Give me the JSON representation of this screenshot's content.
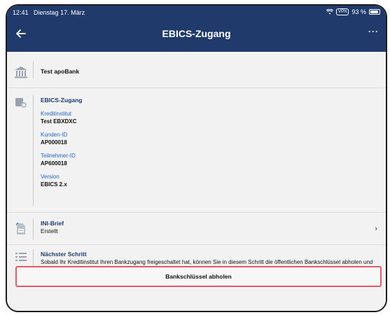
{
  "status": {
    "time": "12:41",
    "date": "Dienstag 17. März",
    "vpn": "VPN",
    "battery": "93 %"
  },
  "nav": {
    "title": "EBICS-Zugang",
    "back_icon": "back-arrow-icon",
    "more_label": "···"
  },
  "bank": {
    "icon": "bank-icon",
    "name": "Test apoBank"
  },
  "ebics": {
    "icon": "ebics-access-icon",
    "title": "EBICS-Zugang",
    "fields": [
      {
        "label": "Kreditinstitut",
        "value": "Test EBXDXC"
      },
      {
        "label": "Kunden-ID",
        "value": "AP000018"
      },
      {
        "label": "Teilnehmer-ID",
        "value": "AP600018"
      },
      {
        "label": "Version",
        "value": "EBICS 2.x"
      }
    ]
  },
  "ini": {
    "icon": "document-icon",
    "title": "INI-Brief",
    "status": "Erstellt",
    "chevron": "›"
  },
  "next": {
    "icon": "list-icon",
    "title": "Nächster Schritt",
    "text": "Sobald Ihr Kreditinstitut Ihren Bankzugang freigeschaltet hat, können Sie in diesem Schritt die öffentlichen Bankschlüssel abholen und freischalten."
  },
  "action": {
    "button_label": "Bankschlüssel abholen"
  },
  "colors": {
    "header": "#1f3a6b",
    "label_blue": "#1f66c2",
    "highlight": "#e05a6a"
  }
}
